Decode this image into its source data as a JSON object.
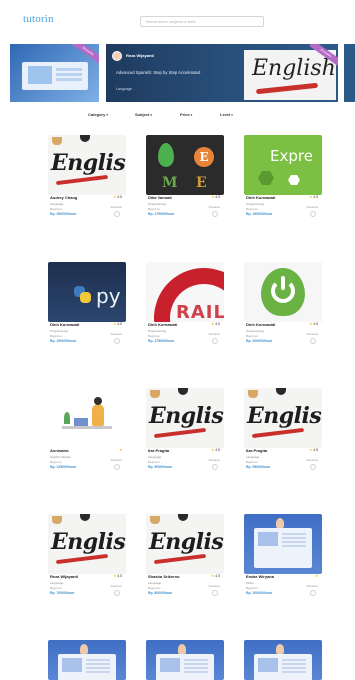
{
  "header": {
    "logo": "tutorin",
    "search_placeholder": "Search tutors, subjects or skills"
  },
  "carousel": {
    "slide": {
      "tutor_name": "Reza Wijayanti",
      "course_title": "Advanced Spanish: Step by Step Accelerated",
      "category": "Language",
      "art_word": "English",
      "ribbon": "Bestseller"
    },
    "left_ribbon": "Bestseller"
  },
  "filters": {
    "category": "Category",
    "subject": "Subject",
    "price": "Price",
    "level": "Level"
  },
  "cards": [
    {
      "tutor": "Audrey Chang",
      "subject": "Language",
      "level": "Beginner",
      "price": "Rp. 250000/hour",
      "rating": "4.5",
      "reviews": "Reviews",
      "thumb": "english"
    },
    {
      "tutor": "Dika Vannati",
      "subject": "Programming",
      "level": "Beginner",
      "price": "Rp. 175000/hour",
      "rating": "4.5",
      "reviews": "Reviews",
      "thumb": "mean"
    },
    {
      "tutor": "Dinh Kurnawati",
      "subject": "Programming",
      "level": "Beginner",
      "price": "Rp. 150000/hour",
      "rating": "4.5",
      "reviews": "Reviews",
      "thumb": "express"
    },
    {
      "tutor": "Dinh Kurnawati",
      "subject": "Programming",
      "level": "Beginner",
      "price": "Rp. 150000/hour",
      "rating": "4.5",
      "reviews": "Reviews",
      "thumb": "python"
    },
    {
      "tutor": "Dinh Kurnawati",
      "subject": "Programming",
      "level": "Beginner",
      "price": "Rp. 175000/hour",
      "rating": "4.5",
      "reviews": "Reviews",
      "thumb": "rails"
    },
    {
      "tutor": "Dinh Kurnawati",
      "subject": "Programming",
      "level": "Beginner",
      "price": "Rp. 200000/hour",
      "rating": "4.5",
      "reviews": "Reviews",
      "thumb": "spring"
    },
    {
      "tutor": "Annisatra",
      "subject": "Graphic Design",
      "level": "Beginner",
      "price": "Rp. 125000/hour",
      "rating": "",
      "reviews": "Reviews",
      "thumb": "illu"
    },
    {
      "tutor": "Ilza Pragita",
      "subject": "Language",
      "level": "Beginner",
      "price": "Rp. 90000/hour",
      "rating": "4.5",
      "reviews": "Reviews",
      "thumb": "english"
    },
    {
      "tutor": "Ilza Pragita",
      "subject": "Language",
      "level": "Beginner",
      "price": "Rp. 95000/hour",
      "rating": "4.5",
      "reviews": "Reviews",
      "thumb": "english"
    },
    {
      "tutor": "Reza Wijayanti",
      "subject": "Language",
      "level": "Beginner",
      "price": "Rp. 70000/hour",
      "rating": "4.5",
      "reviews": "Reviews",
      "thumb": "english"
    },
    {
      "tutor": "Shasha Srikerno",
      "subject": "Language",
      "level": "Beginner",
      "price": "Rp. 80000/hour",
      "rating": "4.5",
      "reviews": "Reviews",
      "thumb": "english"
    },
    {
      "tutor": "Endar Wiryana",
      "subject": "Office",
      "level": "Beginner",
      "price": "Rp. 100000/hour",
      "rating": "",
      "reviews": "Reviews",
      "thumb": "zoom"
    }
  ],
  "colors": {
    "accent": "#4aa3df",
    "price": "#3b8fd0",
    "banner": "#1f3b5f"
  }
}
